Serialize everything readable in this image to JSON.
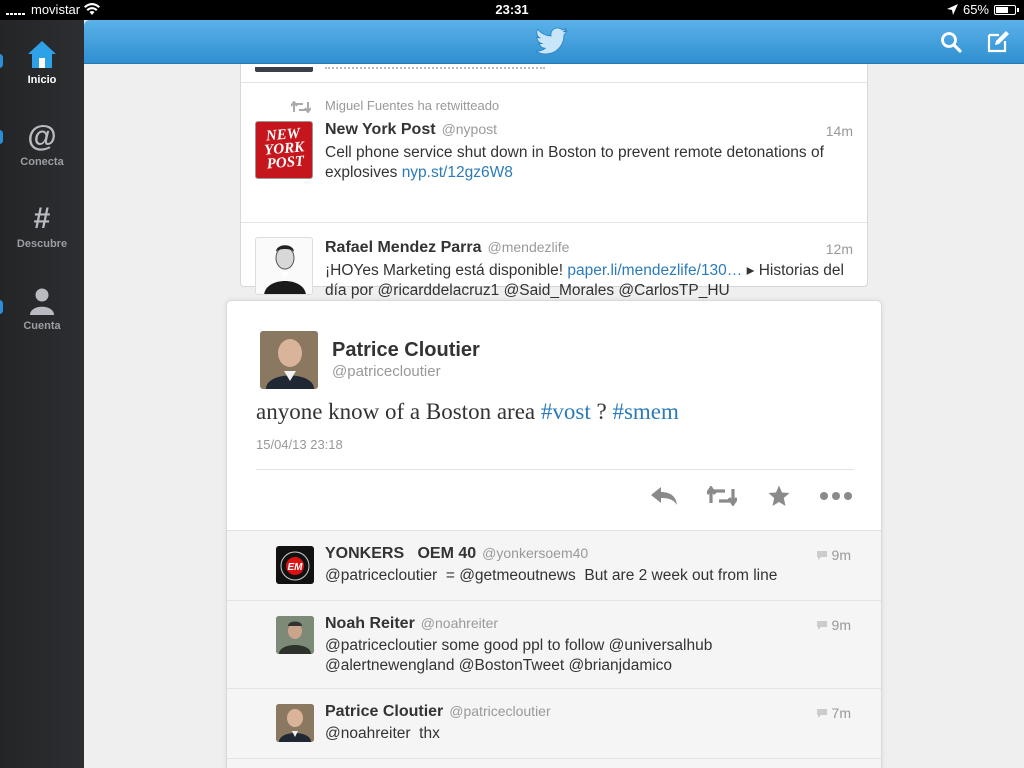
{
  "status_bar": {
    "carrier": "movistar",
    "time": "23:31",
    "battery": "65%",
    "battery_level": 0.65
  },
  "sidebar": {
    "items": [
      {
        "label": "Inicio",
        "icon": "home-icon"
      },
      {
        "label": "Conecta",
        "icon": "at-icon"
      },
      {
        "label": "Descubre",
        "icon": "hash-icon"
      },
      {
        "label": "Cuenta",
        "icon": "person-icon"
      }
    ]
  },
  "topbar": {
    "logo": "twitter-bird-icon",
    "actions": [
      "search-icon",
      "compose-icon"
    ]
  },
  "timeline": {
    "retweet_label": "Miguel Fuentes ha retwitteado",
    "tweets": [
      {
        "name": "New York Post",
        "handle": "@nypost",
        "time": "14m",
        "text": "Cell phone service shut down in Boston to prevent remote detonations of explosives ",
        "link": "nyp.st/12gz6W8",
        "avatar_text": "NEW YORK POST"
      },
      {
        "name": "Rafael Mendez Parra",
        "handle": "@mendezlife",
        "time": "12m",
        "text_before": "¡HOYes Marketing está disponible! ",
        "link": "paper.li/mendezlife/130…",
        "text_after": " ▸ Historias del día por @ricarddelacruz1 @Said_Morales @CarlosTP_HU"
      }
    ]
  },
  "detail": {
    "author_name": "Patrice Cloutier",
    "author_handle": "@patricecloutier",
    "text_before": "anyone know of a Boston area ",
    "hashtag1": "#vost",
    "text_middle": " ? ",
    "hashtag2": "#smem",
    "timestamp": "15/04/13 23:18",
    "actions": [
      "reply-icon",
      "retweet-icon",
      "favorite-star-icon",
      "more-icon"
    ]
  },
  "replies": [
    {
      "name": "YONKERS   OEM 40",
      "handle": "@yonkersoem40",
      "time": "9m",
      "text": "@patricecloutier  = @getmeoutnews  But are 2 week out from line",
      "avatar_text": "EM"
    },
    {
      "name": "Noah Reiter",
      "handle": "@noahreiter",
      "time": "9m",
      "text": "@patricecloutier some good ppl to follow @universalhub @alertnewengland @BostonTweet @brianjdamico"
    },
    {
      "name": "Patrice Cloutier",
      "handle": "@patricecloutier",
      "time": "7m",
      "text": "@noahreiter  thx"
    }
  ],
  "colors": {
    "accent": "#2b7bb9",
    "topbar": "#3d9ddf",
    "sidebar": "#2a2c2f"
  }
}
